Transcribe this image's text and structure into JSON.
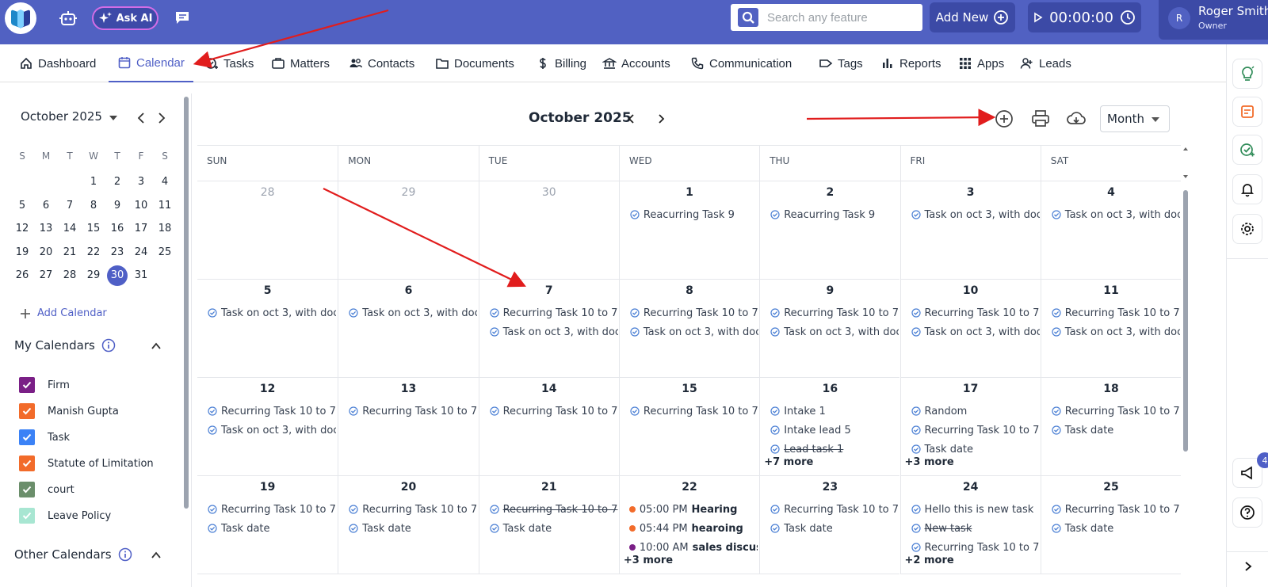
{
  "topbar": {
    "ask_ai": "Ask AI",
    "search_placeholder": "Search any feature",
    "add_new": "Add New",
    "timer": "00:00:00",
    "user_initial": "R",
    "user_name": "Roger Smith",
    "user_role": "Owner",
    "color": "#5161c2"
  },
  "nav": [
    {
      "label": "Dashboard",
      "icon": "home-icon"
    },
    {
      "label": "Calendar",
      "icon": "calendar-icon",
      "active": true
    },
    {
      "label": "Tasks",
      "icon": "task-check-icon"
    },
    {
      "label": "Matters",
      "icon": "briefcase-icon"
    },
    {
      "label": "Contacts",
      "icon": "people-icon"
    },
    {
      "label": "Documents",
      "icon": "folder-icon"
    },
    {
      "label": "Billing",
      "icon": "dollar-icon"
    },
    {
      "label": "Accounts",
      "icon": "bank-icon"
    },
    {
      "label": "Communication",
      "icon": "phone-icon"
    },
    {
      "label": "Tags",
      "icon": "tag-icon"
    },
    {
      "label": "Reports",
      "icon": "bar-chart-icon"
    },
    {
      "label": "Apps",
      "icon": "grid-icon"
    },
    {
      "label": "Leads",
      "icon": "add-person-icon"
    }
  ],
  "rail": {
    "notifications_count": "4"
  },
  "mini_calendar": {
    "title": "October 2025",
    "weekdays": [
      "S",
      "M",
      "T",
      "W",
      "T",
      "F",
      "S"
    ],
    "weeks": [
      [
        "",
        "",
        "",
        "1",
        "2",
        "3",
        "4"
      ],
      [
        "5",
        "6",
        "7",
        "8",
        "9",
        "10",
        "11"
      ],
      [
        "12",
        "13",
        "14",
        "15",
        "16",
        "17",
        "18"
      ],
      [
        "19",
        "20",
        "21",
        "22",
        "23",
        "24",
        "25"
      ],
      [
        "26",
        "27",
        "28",
        "29",
        "30",
        "31",
        ""
      ]
    ],
    "selected": "30"
  },
  "sidebar": {
    "add_calendar": "Add Calendar",
    "my_calendars_title": "My Calendars",
    "my_calendars": [
      {
        "name": "Firm",
        "color": "#7a1f86"
      },
      {
        "name": "Manish Gupta",
        "color": "#f26b2a"
      },
      {
        "name": "Task",
        "color": "#3b82f6"
      },
      {
        "name": "Statute of Limitation",
        "color": "#f26b2a"
      },
      {
        "name": "court",
        "color": "#6b8e6b"
      },
      {
        "name": "Leave Policy",
        "color": "#a8e6d2"
      }
    ],
    "other_calendars_title": "Other Calendars"
  },
  "calendar": {
    "title": "October 2025",
    "view": "Month",
    "days_of_week": [
      "SUN",
      "MON",
      "TUE",
      "WED",
      "THU",
      "FRI",
      "SAT"
    ],
    "weeks": [
      [
        {
          "day": "28",
          "other": true,
          "events": []
        },
        {
          "day": "29",
          "other": true,
          "events": []
        },
        {
          "day": "30",
          "other": true,
          "events": []
        },
        {
          "day": "1",
          "events": [
            {
              "t": "Reacurring Task 9"
            }
          ]
        },
        {
          "day": "2",
          "events": [
            {
              "t": "Reacurring Task 9"
            }
          ]
        },
        {
          "day": "3",
          "events": [
            {
              "t": "Task on oct 3, with doc"
            }
          ]
        },
        {
          "day": "4",
          "events": [
            {
              "t": "Task on oct 3, with doc"
            }
          ]
        }
      ],
      [
        {
          "day": "5",
          "events": [
            {
              "t": "Task on oct 3, with doc"
            }
          ]
        },
        {
          "day": "6",
          "events": [
            {
              "t": "Task on oct 3, with doc"
            }
          ]
        },
        {
          "day": "7",
          "events": [
            {
              "t": "Recurring Task 10 to 7"
            },
            {
              "t": "Task on oct 3, with doc"
            }
          ]
        },
        {
          "day": "8",
          "events": [
            {
              "t": "Recurring Task 10 to 7"
            },
            {
              "t": "Task on oct 3, with doc"
            }
          ]
        },
        {
          "day": "9",
          "events": [
            {
              "t": "Recurring Task 10 to 7"
            },
            {
              "t": "Task on oct 3, with doc"
            }
          ]
        },
        {
          "day": "10",
          "events": [
            {
              "t": "Recurring Task 10 to 7"
            },
            {
              "t": "Task on oct 3, with doc"
            }
          ]
        },
        {
          "day": "11",
          "events": [
            {
              "t": "Recurring Task 10 to 7"
            },
            {
              "t": "Task on oct 3, with doc"
            }
          ]
        }
      ],
      [
        {
          "day": "12",
          "events": [
            {
              "t": "Recurring Task 10 to 7"
            },
            {
              "t": "Task on oct 3, with doc"
            }
          ]
        },
        {
          "day": "13",
          "events": [
            {
              "t": "Recurring Task 10 to 7"
            }
          ]
        },
        {
          "day": "14",
          "events": [
            {
              "t": "Recurring Task 10 to 7"
            }
          ]
        },
        {
          "day": "15",
          "events": [
            {
              "t": "Recurring Task 10 to 7"
            }
          ]
        },
        {
          "day": "16",
          "events": [
            {
              "t": "Intake 1"
            },
            {
              "t": "Intake lead 5"
            },
            {
              "t": "Lead task 1",
              "strike": true
            }
          ],
          "more": "+7 more"
        },
        {
          "day": "17",
          "events": [
            {
              "t": "Random"
            },
            {
              "t": "Recurring Task 10 to 7"
            },
            {
              "t": "Task date"
            }
          ],
          "more": "+3 more"
        },
        {
          "day": "18",
          "events": [
            {
              "t": "Recurring Task 10 to 7"
            },
            {
              "t": "Task date"
            }
          ]
        }
      ],
      [
        {
          "day": "19",
          "events": [
            {
              "t": "Recurring Task 10 to 7"
            },
            {
              "t": "Task date"
            }
          ]
        },
        {
          "day": "20",
          "events": [
            {
              "t": "Recurring Task 10 to 7"
            },
            {
              "t": "Task date"
            }
          ]
        },
        {
          "day": "21",
          "events": [
            {
              "t": "Recurring Task 10 to 7",
              "strike": true
            },
            {
              "t": "Task date"
            }
          ]
        },
        {
          "day": "22",
          "events": [
            {
              "time": "05:00 PM",
              "t": "Hearing",
              "dot": "#f26b2a"
            },
            {
              "time": "05:44 PM",
              "t": "hearoing",
              "dot": "#f26b2a"
            },
            {
              "time": "10:00 AM",
              "t": "sales discussion",
              "dot": "#7a1f86"
            }
          ],
          "more": "+3 more"
        },
        {
          "day": "23",
          "events": [
            {
              "t": "Recurring Task 10 to 7"
            },
            {
              "t": "Task date"
            }
          ]
        },
        {
          "day": "24",
          "events": [
            {
              "t": "Hello this is new task"
            },
            {
              "t": "New task",
              "strike": true
            },
            {
              "t": "Recurring Task 10 to 7"
            }
          ],
          "more": "+2 more"
        },
        {
          "day": "25",
          "events": [
            {
              "t": "Recurring Task 10 to 7"
            },
            {
              "t": "Task date"
            }
          ]
        }
      ]
    ]
  }
}
